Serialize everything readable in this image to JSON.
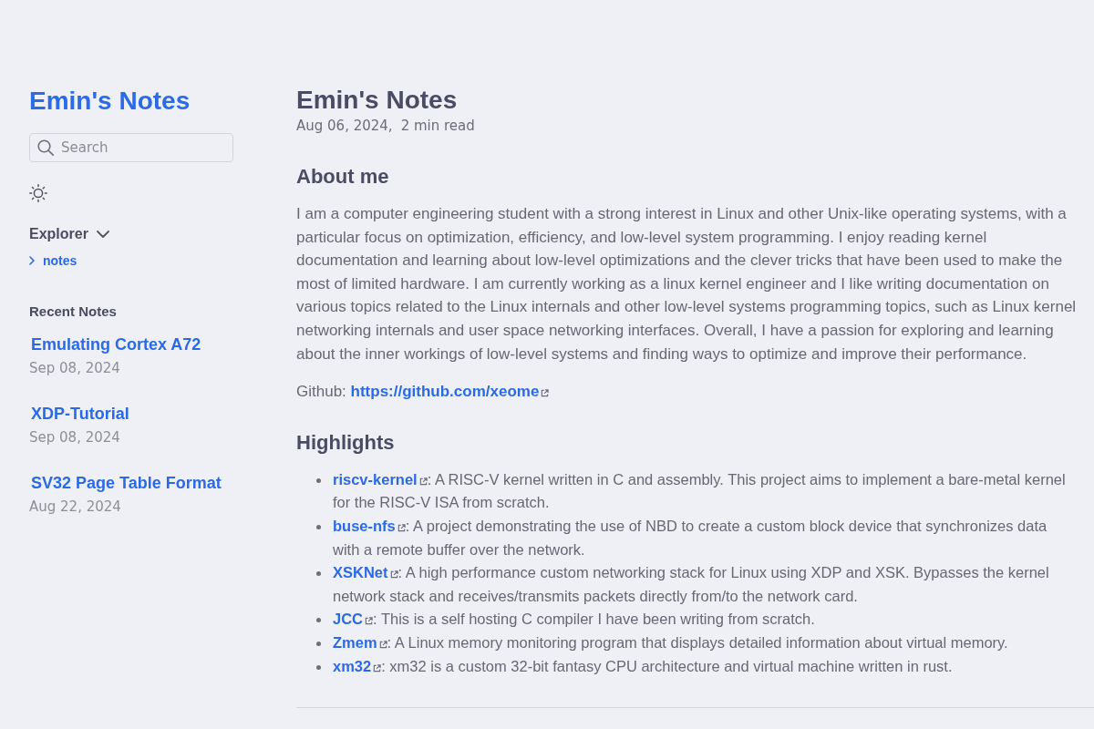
{
  "sidebar": {
    "site_title": "Emin's Notes",
    "search": {
      "placeholder": "Search"
    },
    "explorer": {
      "label": "Explorer",
      "expanded": true,
      "items": [
        {
          "label": "notes",
          "expanded": false
        }
      ]
    },
    "recent_notes": {
      "heading": "Recent Notes",
      "items": [
        {
          "title": "Emulating Cortex A72",
          "date": "Sep 08, 2024"
        },
        {
          "title": "XDP-Tutorial",
          "date": "Sep 08, 2024"
        },
        {
          "title": "SV32 Page Table Format",
          "date": "Aug 22, 2024"
        }
      ]
    }
  },
  "article": {
    "title": "Emin's Notes",
    "date": "Aug 06, 2024,",
    "reading_time": "2 min read",
    "about": {
      "heading": "About me",
      "text": "I am a computer engineering student with a strong interest in Linux and other Unix-like operating systems, with a particular focus on optimization, efficiency, and low-level system programming. I enjoy reading kernel documentation and learning about low-level optimizations and the clever tricks that have been used to make the most of limited hardware. I am currently working as a linux kernel engineer and I like writing documentation on various topics related to the Linux internals and other low-level systems programming topics, such as Linux kernel networking internals and user space networking interfaces. Overall, I have a passion for exploring and learning about the inner workings of low-level systems and finding ways to optimize and improve their performance.",
      "github": {
        "label": "Github:",
        "link": "https://github.com/xeome"
      }
    },
    "highlights": {
      "heading": "Highlights",
      "items": [
        {
          "name": "riscv-kernel",
          "text": ": A RISC-V kernel written in C and assembly. This project aims to implement a bare-metal kernel for the RISC-V ISA from scratch."
        },
        {
          "name": "buse-nfs",
          "text": ": A project demonstrating the use of NBD to create a custom block device that synchronizes data with a remote buffer over the network."
        },
        {
          "name": "XSKNet",
          "text": ": A high performance custom networking stack for Linux using XDP and XSK. Bypasses the kernel network stack and receives/transmits packets directly from/to the network card."
        },
        {
          "name": "JCC",
          "text": ": This is a self hosting C compiler I have been writing from scratch."
        },
        {
          "name": "Zmem",
          "text": ": A Linux memory monitoring program that displays detailed information about virtual memory."
        },
        {
          "name": "xm32",
          "text": ": xm32 is a custom 32-bit fantasy CPU architecture and virtual machine written in rust."
        }
      ]
    }
  }
}
